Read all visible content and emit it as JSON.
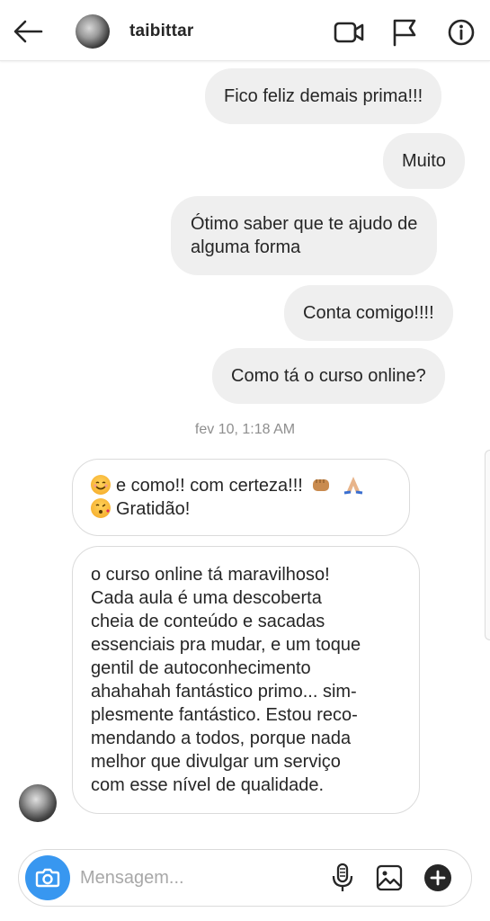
{
  "header": {
    "username": "taibittar",
    "icons": [
      "back-arrow-icon",
      "video-call-icon",
      "flag-icon",
      "info-icon"
    ]
  },
  "messages_sent": [
    "Fico feliz demais prima!!!",
    "Muito",
    "Ótimo saber que te ajudo de",
    "alguma forma",
    "Conta comigo!!!!",
    "Como tá o curso online?"
  ],
  "timestamp": "fev 10, 1:18 AM",
  "messages_received": {
    "first_line1": "e como!! com certeza!!!",
    "first_line2": "Gratidão!",
    "second_lines": [
      "o curso online tá maravilhoso!",
      "Cada aula é uma descoberta",
      "cheia de conteúdo e sacadas",
      "essenciais pra mudar, e um toque",
      "gentil de autoconhecimento",
      "ahahahah fantástico primo... sim-",
      "plesmente fantástico. Estou reco-",
      "mendando a todos, porque nada",
      "melhor que divulgar um serviço",
      "com esse nível de qualidade."
    ]
  },
  "composer": {
    "placeholder": "Mensagem..."
  },
  "colors": {
    "accent": "#3897f0",
    "sent_bubble": "#efefef",
    "received_border": "#dbdbdb",
    "timestamp": "#8e8e8e"
  }
}
